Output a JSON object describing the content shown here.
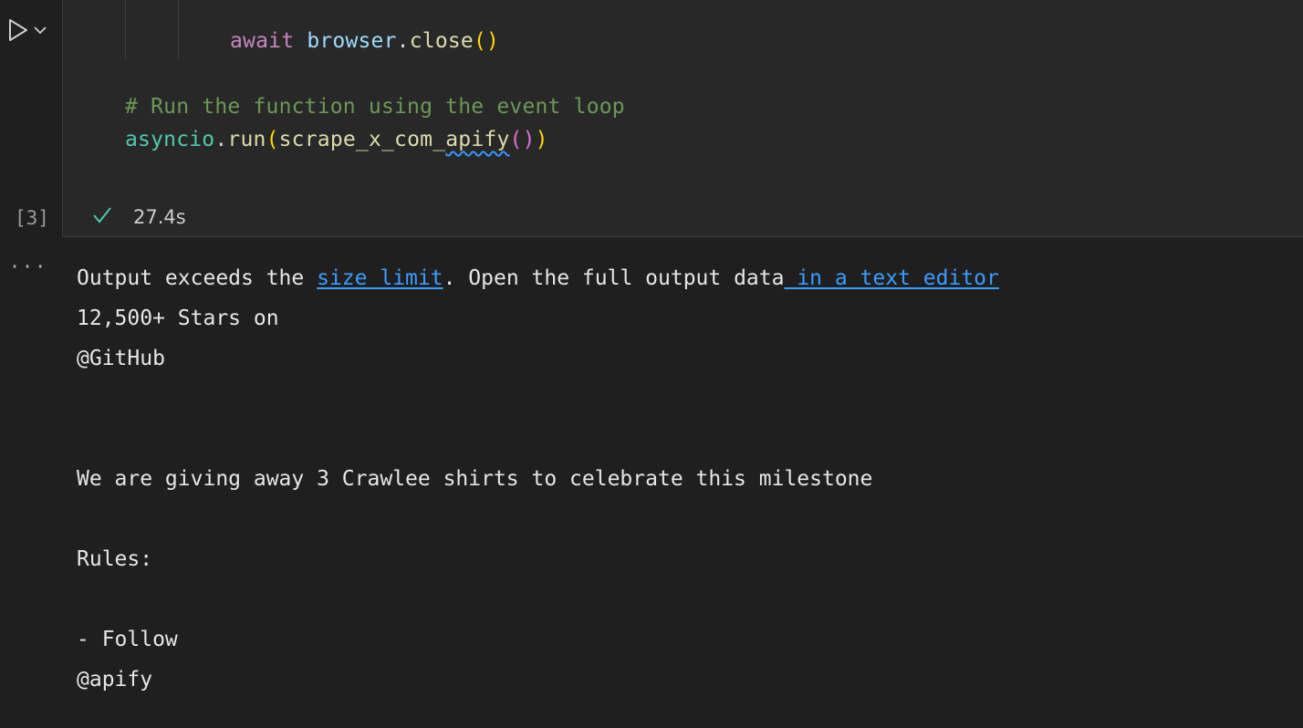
{
  "cell": {
    "code_lines": {
      "line1": {
        "kw": "await",
        "obj": "browser",
        "dot": ".",
        "fn": "close",
        "paren_open": "(",
        "paren_close": ")"
      },
      "line2_comment": "# Run the function using the event loop",
      "line3": {
        "module": "asyncio",
        "dot": ".",
        "fn": "run",
        "p1": "(",
        "inner_fn_a": "scrape_x_com_",
        "inner_fn_b": "apify",
        "p2": "(",
        "p3": ")",
        "p4": ")"
      }
    },
    "execution_count": "[3]",
    "duration": "27.4s"
  },
  "output": {
    "notice_prefix": "Output exceeds the ",
    "size_limit_link": "size limit",
    "notice_middle": ". Open the full output data",
    "text_editor_link": " in a text editor",
    "lines": [
      "12,500+ Stars on",
      "@GitHub",
      "",
      "",
      "We are giving away 3 Crawlee shirts to celebrate this milestone",
      "",
      "Rules:",
      "",
      "- Follow",
      "@apify"
    ],
    "more_label": "···"
  },
  "colors": {
    "background": "#1f1f1f",
    "cell_background": "#282828",
    "link": "#3b9cff",
    "success_check": "#4ec9b0"
  }
}
